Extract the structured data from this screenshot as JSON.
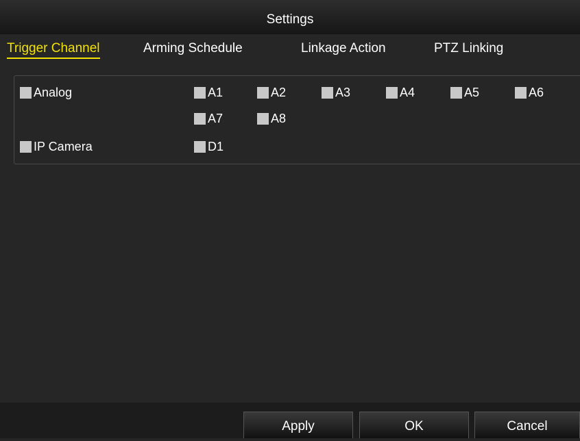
{
  "window": {
    "title": "Settings"
  },
  "tabs": [
    {
      "label": "Trigger Channel",
      "active": true
    },
    {
      "label": "Arming Schedule",
      "active": false
    },
    {
      "label": "Linkage Action",
      "active": false
    },
    {
      "label": "PTZ Linking",
      "active": false
    }
  ],
  "trigger": {
    "analog": {
      "label": "Analog",
      "checked": false
    },
    "analog_channels": [
      {
        "label": "A1",
        "checked": false
      },
      {
        "label": "A2",
        "checked": false
      },
      {
        "label": "A3",
        "checked": false
      },
      {
        "label": "A4",
        "checked": false
      },
      {
        "label": "A5",
        "checked": false
      },
      {
        "label": "A6",
        "checked": false
      },
      {
        "label": "A7",
        "checked": false
      },
      {
        "label": "A8",
        "checked": false
      }
    ],
    "ip_camera": {
      "label": "IP Camera",
      "checked": false
    },
    "ip_channels": [
      {
        "label": "D1",
        "checked": false
      }
    ]
  },
  "buttons": {
    "apply": "Apply",
    "ok": "OK",
    "cancel": "Cancel"
  },
  "colors": {
    "active_tab": "#f2e200",
    "background": "#262626",
    "checkbox": "#c8c8c8"
  }
}
